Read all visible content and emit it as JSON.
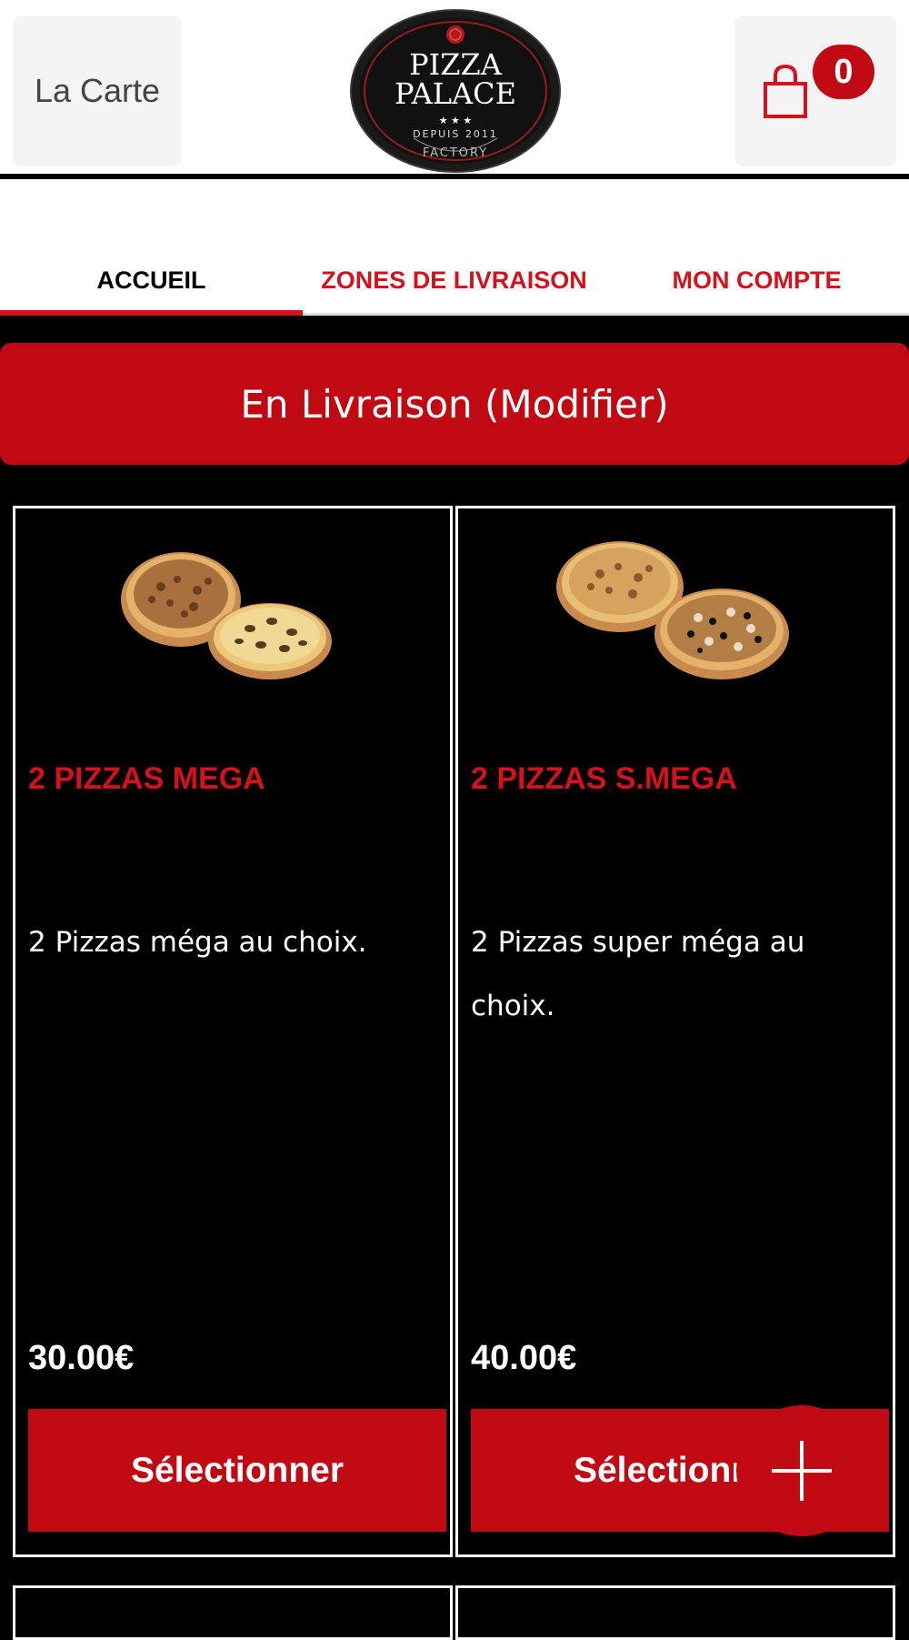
{
  "header": {
    "menu_label": "La Carte",
    "cart_count": "0",
    "logo": {
      "line1": "PIZZA",
      "line2": "PALACE",
      "stars": "★ ★ ★",
      "since": "DEPUIS 2011",
      "factory": "FACTORY"
    }
  },
  "tabs": [
    {
      "label": "ACCUEIL",
      "active": true
    },
    {
      "label": "ZONES DE LIVRAISON",
      "active": false
    },
    {
      "label": "MON COMPTE",
      "active": false
    }
  ],
  "delivery_label": "En Livraison (Modifier)",
  "products": [
    {
      "name": "2 PIZZAS MEGA",
      "description": "2 Pizzas méga au choix.",
      "price": "30.00€",
      "button_label": "Sélectionner"
    },
    {
      "name": "2 PIZZAS S.MEGA",
      "description": "2 Pizzas super méga au choix.",
      "price": "40.00€",
      "button_label": "Sélectionner"
    }
  ],
  "icons": {
    "cart": "shopping-bag-icon",
    "fab": "plus-icon"
  },
  "colors": {
    "brand_red": "#c10914",
    "tab_red": "#d4111c",
    "background": "#000000",
    "header_bg": "#ffffff"
  }
}
